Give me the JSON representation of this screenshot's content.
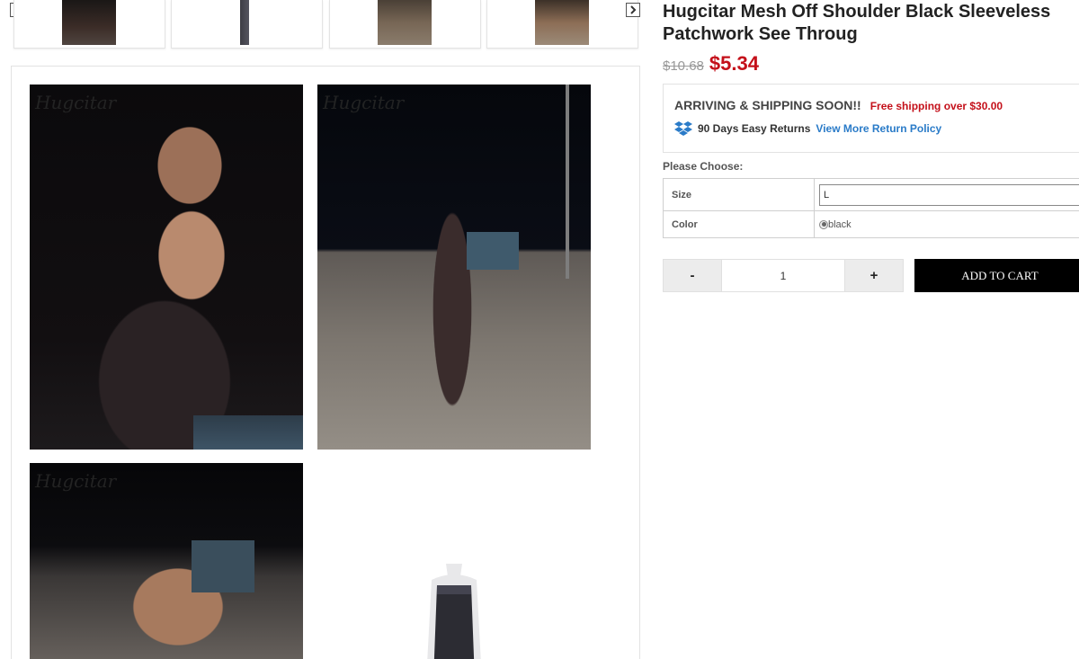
{
  "thumbnails": {
    "prev_icon": "chevron-left-icon",
    "next_icon": "chevron-right-icon",
    "count": 4
  },
  "gallery": {
    "watermark": "Hugcitar"
  },
  "product": {
    "title": "Hugcitar Mesh Off Shoulder Black Sleeveless Patchwork See Throug",
    "old_price": "$10.68",
    "new_price": "$5.34",
    "price_color": "#c4101a"
  },
  "shipping": {
    "heading": "ARRIVING & SHIPPING SOON!!",
    "free_shipping": "Free shipping over $30.00",
    "returns_text": "90 Days Easy Returns",
    "returns_link": "View More Return Policy",
    "returns_icon": "dropbox-icon",
    "link_color": "#2a7bc8"
  },
  "options": {
    "choose_label": "Please Choose:",
    "size_label": "Size",
    "size_value": "L",
    "color_label": "Color",
    "color_value": "black"
  },
  "cart": {
    "minus": "-",
    "quantity": "1",
    "plus": "+",
    "add_to_cart": "ADD TO CART"
  }
}
